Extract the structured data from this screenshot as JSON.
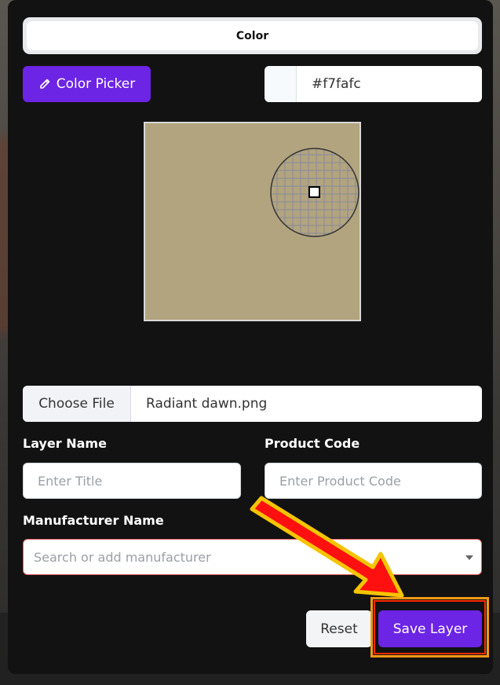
{
  "tabs": {
    "active_label": "Color"
  },
  "color_picker": {
    "button_label": "Color Picker",
    "hex_value": "#f7fafc",
    "swatch_color": "#f7fafc",
    "canvas_color": "#b2a47f"
  },
  "file": {
    "button_label": "Choose File",
    "file_name": "Radiant dawn.png"
  },
  "layer": {
    "label": "Layer Name",
    "placeholder": "Enter Title"
  },
  "product": {
    "label": "Product Code",
    "placeholder": "Enter Product Code"
  },
  "manufacturer": {
    "label": "Manufacturer Name",
    "placeholder": "Search or add manufacturer"
  },
  "actions": {
    "reset_label": "Reset",
    "save_label": "Save Layer"
  },
  "colors": {
    "accent": "#6c24e5",
    "highlight_arrow": "#ff1a1a",
    "highlight_outline": "#f29a14"
  },
  "icons": {
    "picker_icon": "pencil-icon",
    "dropdown_icon": "chevron-down-icon"
  }
}
